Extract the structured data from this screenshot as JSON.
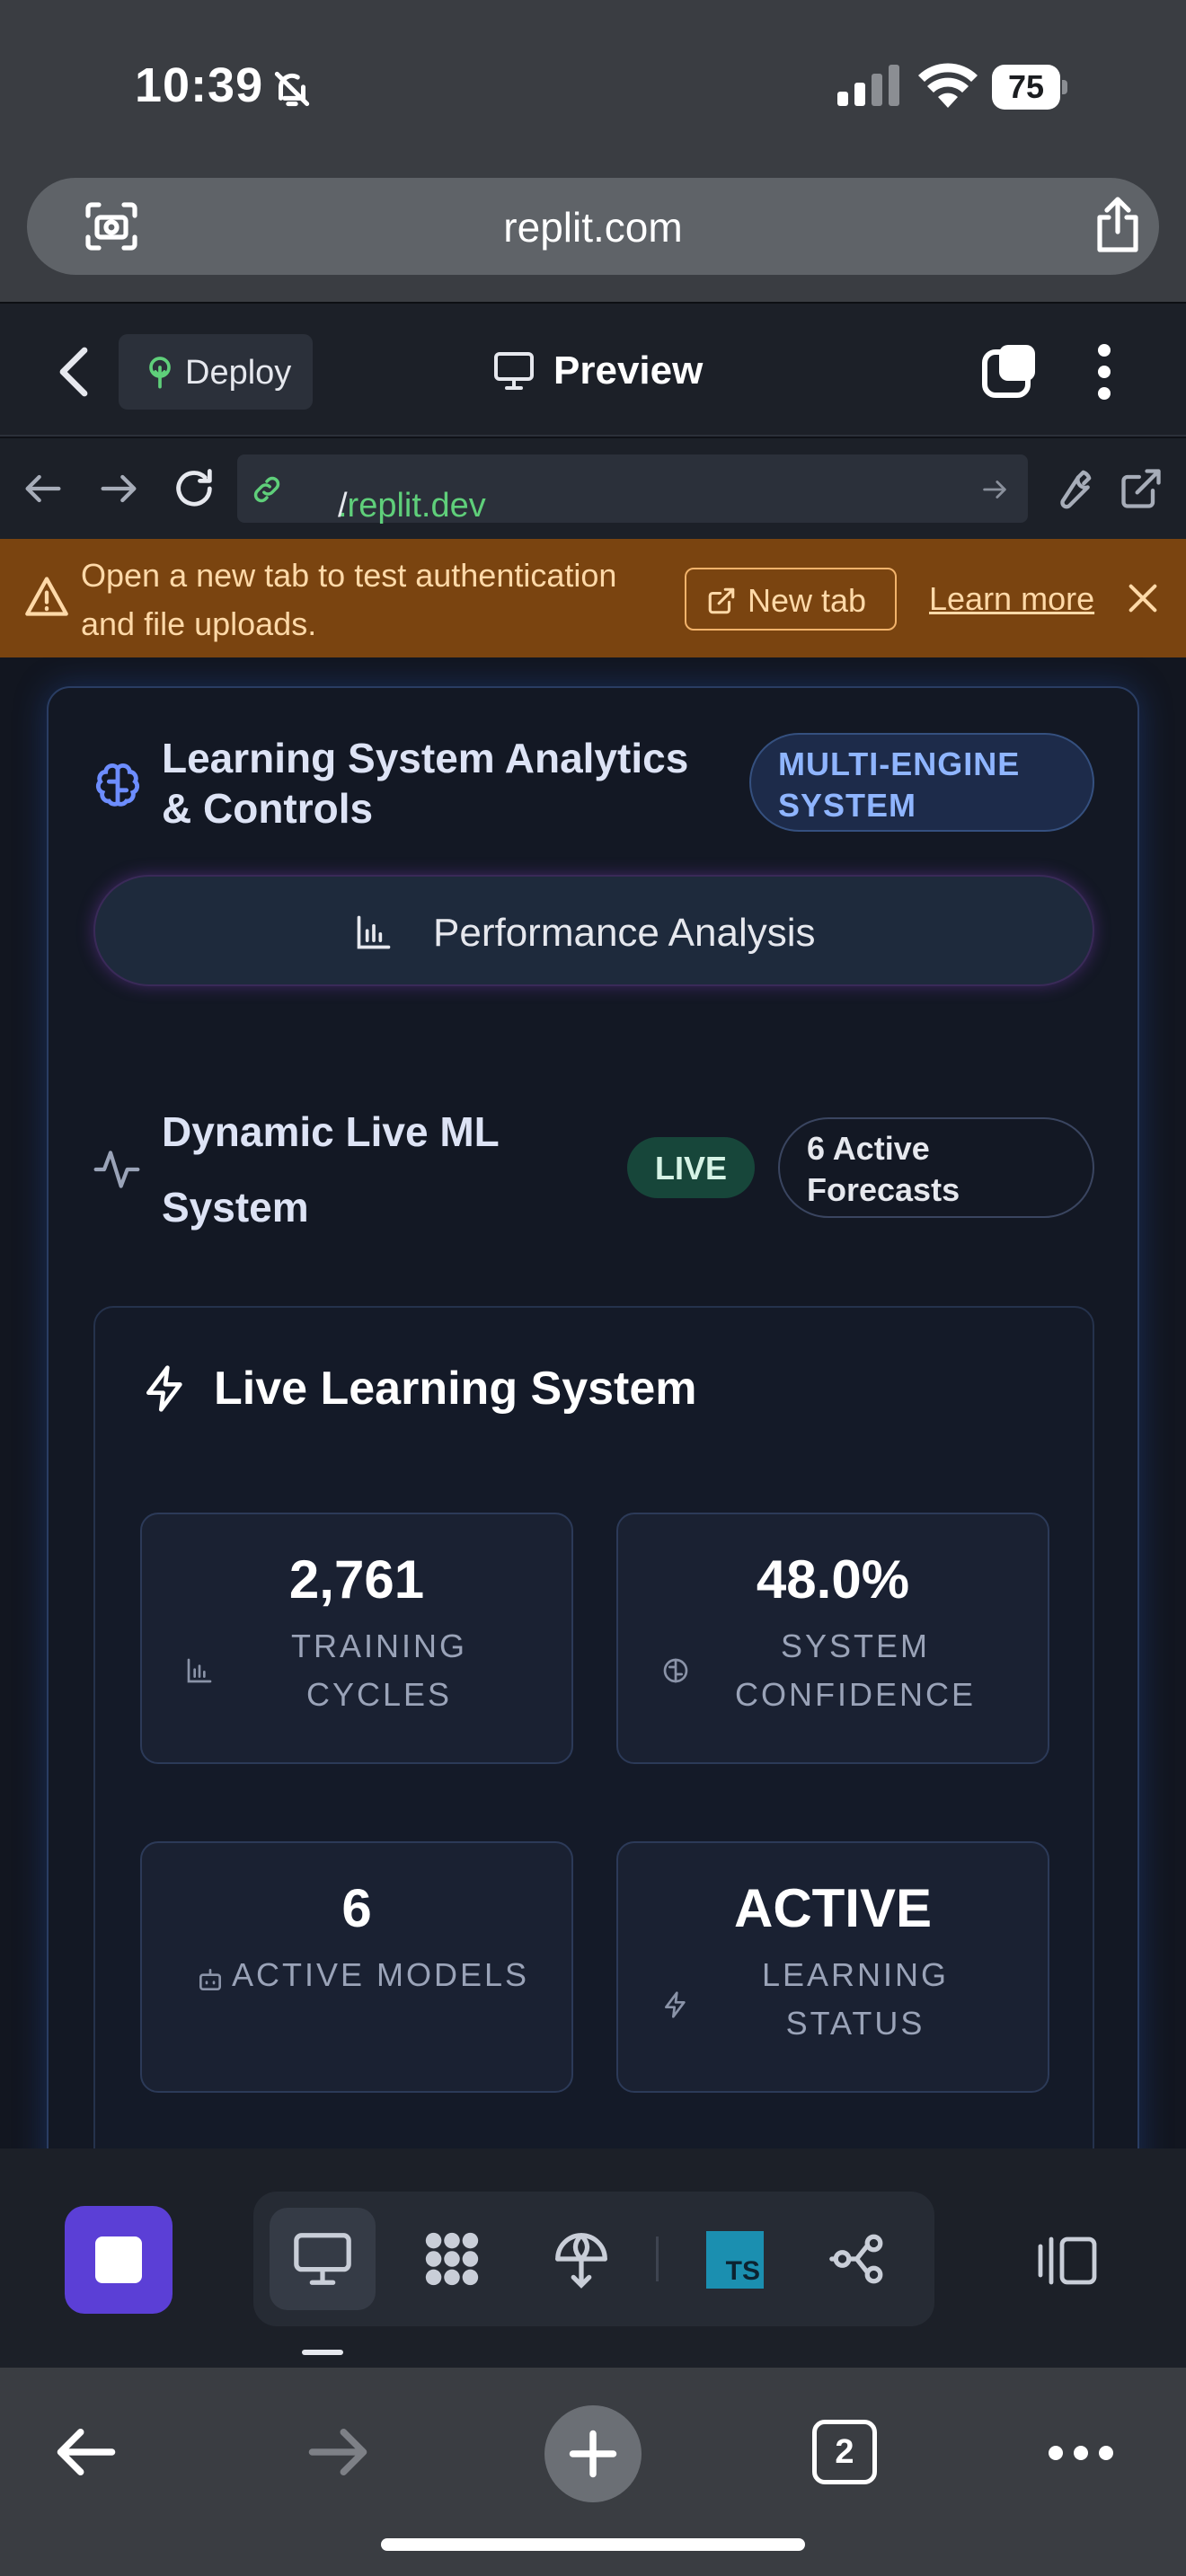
{
  "status_bar": {
    "time": "10:39",
    "battery": "75"
  },
  "safari": {
    "url": "replit.com"
  },
  "replit_header": {
    "deploy_label": "Deploy",
    "title": "Preview"
  },
  "browser_bar": {
    "url_host": ".replit.dev",
    "url_path": "/"
  },
  "banner": {
    "message": "Open a new tab to test authentication and file uploads.",
    "new_tab_label": "New tab",
    "learn_more_label": "Learn more"
  },
  "card": {
    "title": "Learning System Analytics & Controls",
    "badge": "MULTI-ENGINE SYSTEM",
    "performance_button": "Performance Analysis",
    "dynamic_title": "Dynamic Live ML System",
    "live_badge": "LIVE",
    "forecast_badge": "6 Active Forecasts"
  },
  "live_panel": {
    "title": "Live Learning System",
    "stats": [
      {
        "value": "2,761",
        "label": "TRAINING CYCLES",
        "icon": "bar-chart-icon"
      },
      {
        "value": "48.0%",
        "label": "SYSTEM CONFIDENCE",
        "icon": "brain-icon"
      },
      {
        "value": "6",
        "label": "ACTIVE MODELS",
        "icon": "bot-icon"
      },
      {
        "value": "ACTIVE",
        "label": "LEARNING STATUS",
        "icon": "bolt-icon"
      }
    ]
  },
  "bottom_toolbar": {
    "ts_badge": "TS"
  },
  "safari_bottom": {
    "tab_count": "2"
  },
  "colors": {
    "accent_purple": "#5b3fd6",
    "banner_bg": "#7a4410",
    "live_green": "#17463a",
    "badge_blue": "#8fb5ff",
    "link_green": "#5fcf7a"
  }
}
